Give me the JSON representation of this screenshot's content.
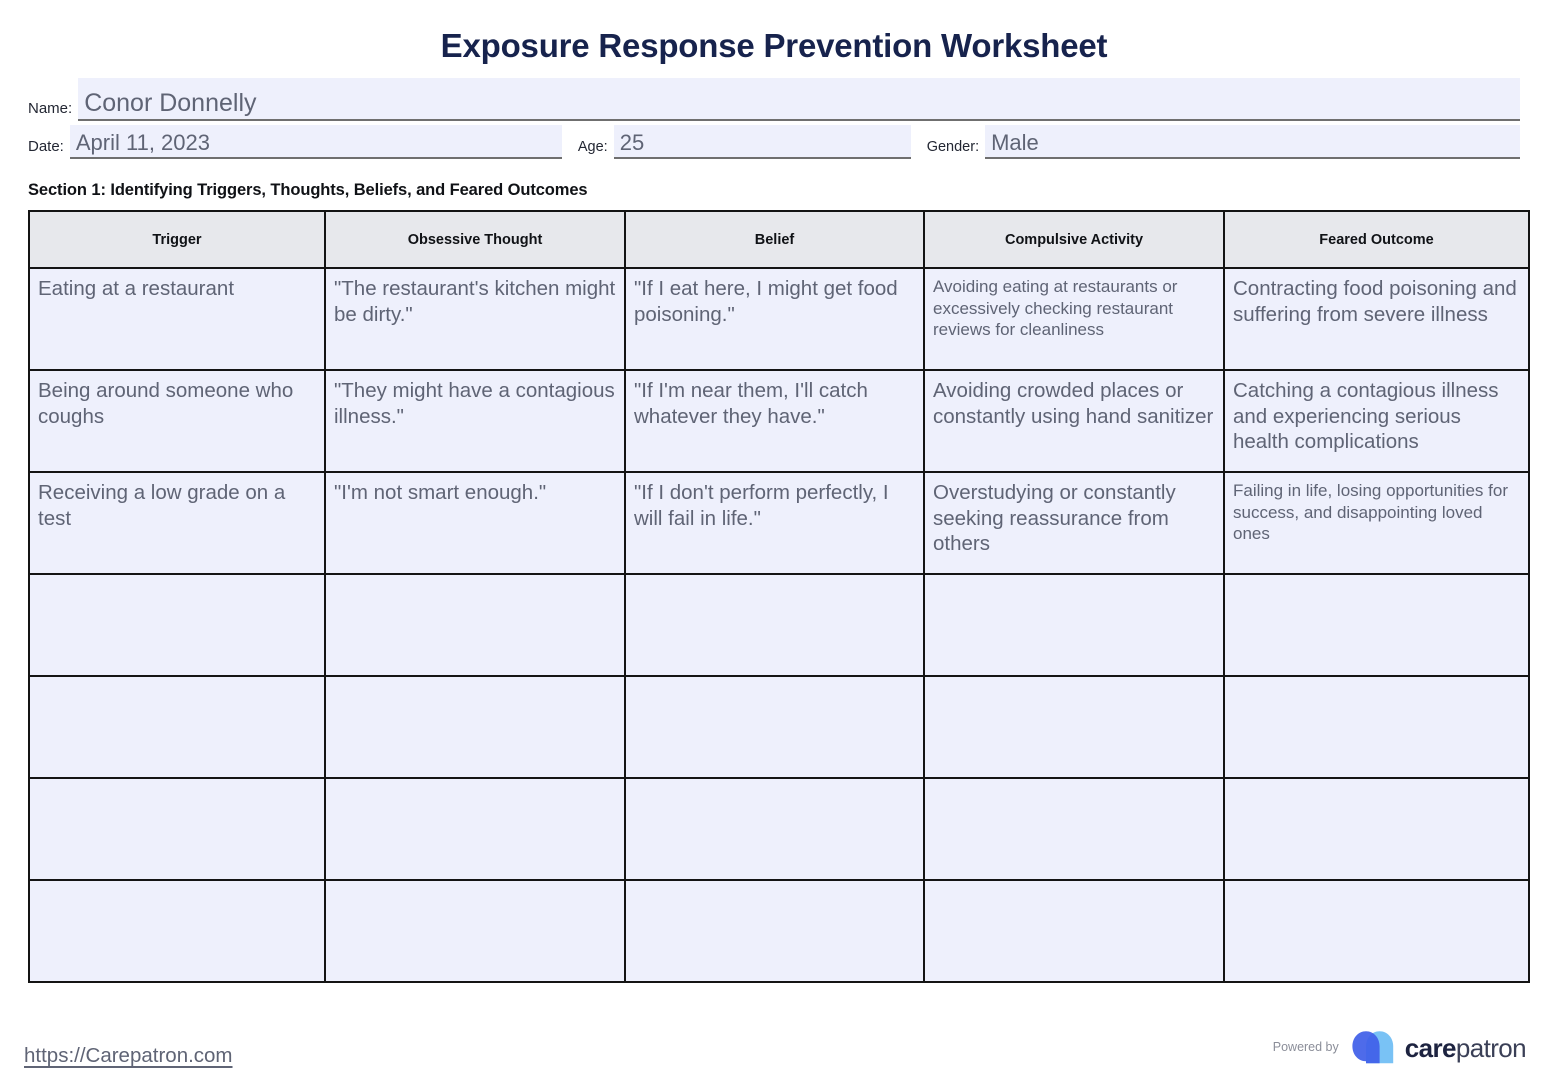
{
  "document": {
    "title": "Exposure Response Prevention Worksheet"
  },
  "identification": {
    "name_label": "Name:",
    "name_value": "Conor Donnelly",
    "date_label": "Date:",
    "date_value": "April 11, 2023",
    "age_label": "Age:",
    "age_value": "25",
    "gender_label": "Gender:",
    "gender_value": "Male"
  },
  "section1": {
    "heading": "Section 1: Identifying Triggers, Thoughts, Beliefs, and Feared Outcomes",
    "columns": [
      "Trigger",
      "Obsessive Thought",
      "Belief",
      "Compulsive Activity",
      "Feared Outcome"
    ],
    "rows": [
      {
        "trigger": "Eating at a restaurant",
        "obsessive_thought": "\"The restaurant's kitchen might be dirty.\"",
        "belief": "\"If I eat here, I might get food poisoning.\"",
        "compulsive_activity": "Avoiding eating at restaurants or excessively checking restaurant reviews for cleanliness",
        "feared_outcome": "Contracting food poisoning and suffering from severe illness"
      },
      {
        "trigger": "Being around someone who coughs",
        "obsessive_thought": "\"They might have a contagious illness.\"",
        "belief": "\"If I'm near them, I'll catch whatever they have.\"",
        "compulsive_activity": "Avoiding crowded places or constantly using hand sanitizer",
        "feared_outcome": "Catching a contagious illness and experiencing serious health complications"
      },
      {
        "trigger": "Receiving a low grade on a test",
        "obsessive_thought": "\"I'm not smart enough.\"",
        "belief": "\"If I don't perform perfectly, I will fail in life.\"",
        "compulsive_activity": "Overstudying or constantly seeking reassurance from others",
        "feared_outcome": "Failing in life, losing opportunities for success, and disappointing loved ones"
      },
      {
        "trigger": "",
        "obsessive_thought": "",
        "belief": "",
        "compulsive_activity": "",
        "feared_outcome": ""
      },
      {
        "trigger": "",
        "obsessive_thought": "",
        "belief": "",
        "compulsive_activity": "",
        "feared_outcome": ""
      },
      {
        "trigger": "",
        "obsessive_thought": "",
        "belief": "",
        "compulsive_activity": "",
        "feared_outcome": ""
      },
      {
        "trigger": "",
        "obsessive_thought": "",
        "belief": "",
        "compulsive_activity": "",
        "feared_outcome": ""
      }
    ]
  },
  "footer": {
    "url": "https://Carepatron.com",
    "powered_by": "Powered by",
    "brand_bold": "care",
    "brand_light": "patron",
    "colors": {
      "logo_dark_blue": "#4160e8",
      "logo_light_blue": "#79c2f5",
      "title_navy": "#17234d",
      "field_fill": "#eef0fc",
      "header_fill": "#e7e8ec"
    }
  }
}
